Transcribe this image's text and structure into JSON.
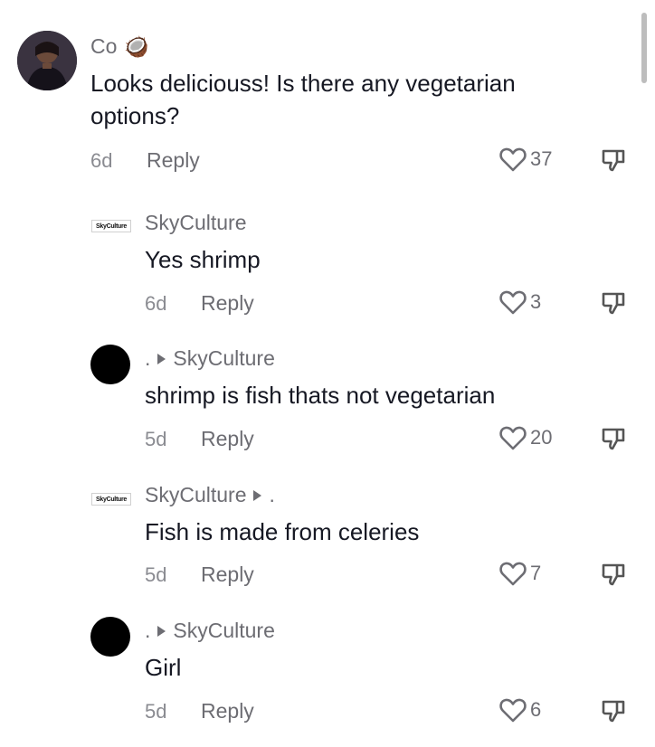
{
  "comments": [
    {
      "username": "Co",
      "badge_emoji": "🥥",
      "text_line1": "Looks deliciouss! Is there any vegetarian",
      "text_line2": "options?",
      "time": "6d",
      "reply_label": "Reply",
      "likes": "37"
    },
    {
      "username": "SkyCulture",
      "avatar_logo_text": "SkyCulture",
      "text": "Yes shrimp",
      "time": "6d",
      "reply_label": "Reply",
      "likes": "3"
    },
    {
      "username": ".",
      "reply_to": "SkyCulture",
      "text": "shrimp is fish thats not vegetarian",
      "time": "5d",
      "reply_label": "Reply",
      "likes": "20"
    },
    {
      "username": "SkyCulture",
      "avatar_logo_text": "SkyCulture",
      "reply_to": ".",
      "text": "Fish is made from celeries",
      "time": "5d",
      "reply_label": "Reply",
      "likes": "7"
    },
    {
      "username": ".",
      "reply_to": "SkyCulture",
      "text": "Girl",
      "time": "5d",
      "reply_label": "Reply",
      "likes": "6"
    }
  ],
  "icons": {
    "like": "heart-outline-icon",
    "dislike": "thumbs-down-icon",
    "reply_arrow": "triangle-right-icon"
  },
  "colors": {
    "text": "#161823",
    "secondary": "#6d6d73",
    "muted": "#8a8b91"
  }
}
